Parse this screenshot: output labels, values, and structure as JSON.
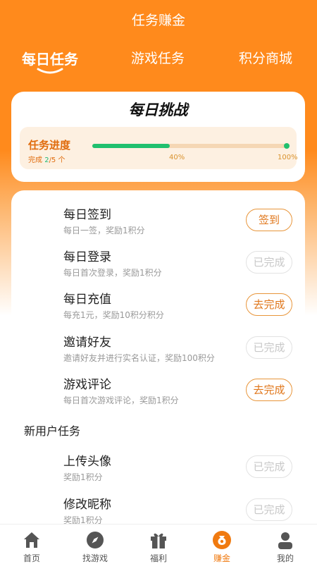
{
  "header": {
    "title": "任务赚金"
  },
  "tabs": [
    {
      "label": "每日任务",
      "active": true
    },
    {
      "label": "游戏任务",
      "active": false
    },
    {
      "label": "积分商城",
      "active": false
    }
  ],
  "challenge": {
    "title": "每日挑战",
    "progress_label": "任务进度",
    "done_prefix": "完成 ",
    "done_count": "2",
    "done_suffix": "/5 个",
    "progress_fraction": 0.4,
    "pct_mid": "40%",
    "pct_end": "100%"
  },
  "tasks": [
    {
      "name": "每日签到",
      "desc": "每日一签，奖励1积分",
      "button": "签到",
      "state": "todo"
    },
    {
      "name": "每日登录",
      "desc": "每日首次登录，奖励1积分",
      "button": "已完成",
      "state": "done"
    },
    {
      "name": "每日充值",
      "desc": "每充1元，奖励10积分积分",
      "button": "去完成",
      "state": "todo"
    },
    {
      "name": "邀请好友",
      "desc": "邀请好友并进行实名认证，奖励100积分",
      "button": "已完成",
      "state": "done"
    },
    {
      "name": "游戏评论",
      "desc": "每日首次游戏评论，奖励1积分",
      "button": "去完成",
      "state": "todo"
    }
  ],
  "new_user": {
    "title": "新用户任务",
    "tasks": [
      {
        "name": "上传头像",
        "desc": "奖励1积分",
        "button": "已完成",
        "state": "done"
      },
      {
        "name": "修改昵称",
        "desc": "奖励1积分",
        "button": "已完成",
        "state": "done"
      }
    ]
  },
  "nav": [
    {
      "label": "首页",
      "icon": "home-icon"
    },
    {
      "label": "找游戏",
      "icon": "compass-icon"
    },
    {
      "label": "福利",
      "icon": "gift-icon"
    },
    {
      "label": "赚金",
      "icon": "coin-bag-icon",
      "active": true
    },
    {
      "label": "我的",
      "icon": "user-icon"
    }
  ],
  "colors": {
    "accent": "#ff8a1c",
    "progress": "#20c06e",
    "nav_active": "#f07a10"
  }
}
